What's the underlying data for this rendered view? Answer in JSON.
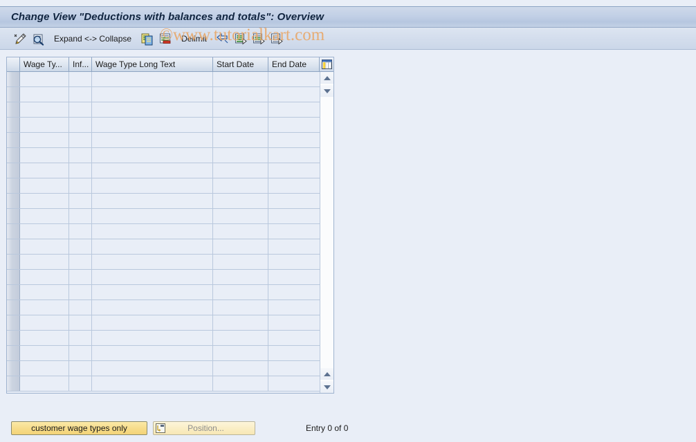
{
  "window": {
    "title": "Change View \"Deductions with balances and totals\": Overview"
  },
  "watermark": {
    "text": "©www.tutorialkart.com",
    "color": "#e8a86a"
  },
  "toolbar": {
    "items": [
      {
        "name": "change-entry-icon",
        "icon": "pencil-wand-icon",
        "label": ""
      },
      {
        "name": "display-details-icon",
        "icon": "magnifier-document-icon",
        "label": ""
      },
      {
        "name": "expand-collapse-button",
        "icon": "",
        "label": "Expand <-> Collapse"
      },
      {
        "name": "copy-as-icon",
        "icon": "copy-documents-icon",
        "label": ""
      },
      {
        "name": "delete-row-icon",
        "icon": "delete-row-icon",
        "label": ""
      },
      {
        "name": "delimit-button",
        "icon": "",
        "label": "Delimit"
      },
      {
        "name": "undo-icon",
        "icon": "undo-arrow-icon",
        "label": ""
      },
      {
        "name": "select-all-icon",
        "icon": "list-select-icon-1",
        "label": ""
      },
      {
        "name": "select-block-icon",
        "icon": "list-select-icon-2",
        "label": ""
      },
      {
        "name": "deselect-all-icon",
        "icon": "list-select-icon-3",
        "label": ""
      }
    ]
  },
  "table": {
    "columns": [
      {
        "key": "selector",
        "label": ""
      },
      {
        "key": "wage_type",
        "label": "Wage Ty..."
      },
      {
        "key": "infotype",
        "label": "Inf..."
      },
      {
        "key": "long_text",
        "label": "Wage Type Long Text"
      },
      {
        "key": "start_date",
        "label": "Start Date"
      },
      {
        "key": "end_date",
        "label": "End Date"
      }
    ],
    "config_icon": "table-settings-icon",
    "rows": [],
    "empty_row_count": 21,
    "scrollbar": {
      "up_arrow": "arrow-up-icon",
      "down_arrow": "arrow-down-icon"
    }
  },
  "footer": {
    "customer_wage_types_label": "customer wage types only",
    "position_label": "Position...",
    "position_icon": "position-icon",
    "entry_status": "Entry 0 of 0"
  },
  "colors": {
    "background": "#e9eef7",
    "title_bar": "#c2d0e6",
    "grid_cell": "#e9eef7",
    "grid_line": "#b9c8dd",
    "accent_yellow": "#f3d377"
  }
}
